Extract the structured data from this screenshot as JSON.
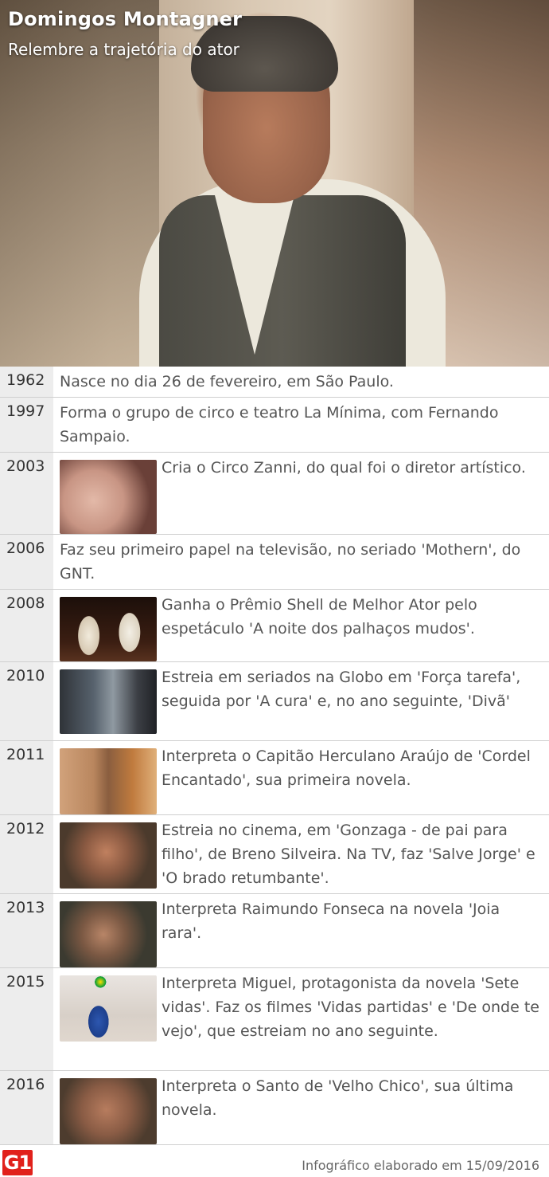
{
  "header": {
    "title": "Domingos Montagner",
    "subtitle": "Relembre a trajetória do ator"
  },
  "timeline": [
    {
      "year": "1962",
      "text": "Nasce no dia 26 de fevereiro, em São Paulo."
    },
    {
      "year": "1997",
      "text": "Forma o grupo de circo e teatro La Mínima, com Fernando Sampaio."
    },
    {
      "year": "2003",
      "text": "Cria o Circo Zanni, do qual foi o diretor artístico."
    },
    {
      "year": "2006",
      "text": "Faz seu primeiro papel na televisão, no seriado 'Mothern', do GNT."
    },
    {
      "year": "2008",
      "text": "Ganha o Prêmio Shell de Melhor Ator pelo espetáculo 'A noite dos palhaços mudos'."
    },
    {
      "year": "2010",
      "text": "Estreia em seriados na Globo em 'Força tarefa', seguida por 'A cura' e, no ano seguinte, 'Divã'"
    },
    {
      "year": "2011",
      "text": "Interpreta o Capitão Herculano Araújo de 'Cordel Encantado', sua primeira novela."
    },
    {
      "year": "2012",
      "text": "Estreia no cinema, em 'Gonzaga - de pai para filho', de Breno Silveira. Na TV, faz 'Salve Jorge' e 'O brado retumbante'."
    },
    {
      "year": "2013",
      "text": "Interpreta Raimundo Fonseca na novela 'Joia rara'."
    },
    {
      "year": "2015",
      "text": "Interpreta Miguel, protagonista da novela 'Sete vidas'. Faz os filmes 'Vidas partidas' e 'De onde te vejo', que estreiam no ano seguinte."
    },
    {
      "year": "2016",
      "text": "Interpreta o Santo de 'Velho Chico', sua última novela."
    }
  ],
  "footer": {
    "logo": "G1",
    "credit": "Infográfico elaborado em 15/09/2016"
  }
}
